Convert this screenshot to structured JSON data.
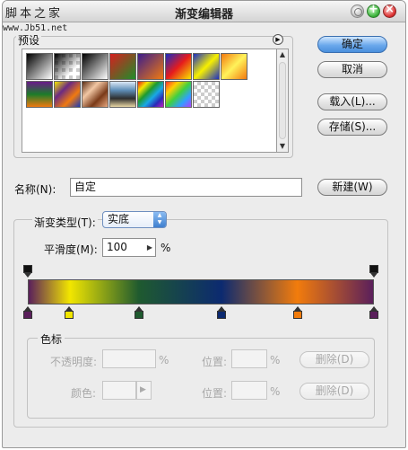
{
  "watermark": {
    "text": "脚本之家",
    "url": "www.Jb51.net"
  },
  "window": {
    "title": "渐变编辑器"
  },
  "presets": {
    "label": "预设",
    "swatches": [
      {
        "name": "foreground-to-background",
        "bg": "linear-gradient(135deg,#000,#fff)"
      },
      {
        "name": "foreground-to-transparent",
        "bg": "checker-black"
      },
      {
        "name": "black-white",
        "bg": "linear-gradient(135deg,#000,#fff)"
      },
      {
        "name": "red-green",
        "bg": "linear-gradient(135deg,#d61f1f,#1e8e2a)"
      },
      {
        "name": "violet-orange",
        "bg": "linear-gradient(135deg,#3b1d8c,#f07a10)"
      },
      {
        "name": "blue-red-yellow",
        "bg": "linear-gradient(135deg,#1a2bc0,#e61c1c,#f6e600)"
      },
      {
        "name": "blue-yellow-blue",
        "bg": "linear-gradient(135deg,#1c2fc4,#f7f000,#1c2fc4)"
      },
      {
        "name": "orange-yellow-orange",
        "bg": "linear-gradient(135deg,#f37a0f,#fff25a,#f37a0f)"
      },
      {
        "name": "violet-green-orange",
        "bg": "linear-gradient(to bottom,#6a1b8a,#1c7c2a,#f07a10)"
      },
      {
        "name": "yellow-violet-orange-blue",
        "bg": "linear-gradient(135deg,#f4e800,#6b2a82,#f07a10,#1d3ab5)"
      },
      {
        "name": "copper",
        "bg": "linear-gradient(135deg,#5a2c14,#f2c7a4,#7a3a18,#e8a880)"
      },
      {
        "name": "chrome",
        "bg": "linear-gradient(to bottom,#dbe8f5,#5f8fb8,#2e2e2e,#e9d7a4)"
      },
      {
        "name": "spectrum",
        "bg": "linear-gradient(135deg,#e61c1c,#f6e600,#1e9a2e,#19a8e6,#2a2ab8,#c21ec2)"
      },
      {
        "name": "transparent-rainbow",
        "bg": "linear-gradient(135deg,#ff3030,#ffd000,#40d040,#30a0ff,#b040ff)"
      },
      {
        "name": "transparent-stripes",
        "bg": "checker-light"
      }
    ]
  },
  "buttons": {
    "ok": "确定",
    "cancel": "取消",
    "load": "载入(L)...",
    "save": "存储(S)...",
    "new": "新建(W)",
    "delete_opacity": "删除(D)",
    "delete_color": "删除(D)"
  },
  "name_field": {
    "label": "名称(N):",
    "value": "自定"
  },
  "gradient_type": {
    "label": "渐变类型(T):",
    "value": "实底"
  },
  "smoothness": {
    "label": "平滑度(M):",
    "value": "100",
    "unit": "%"
  },
  "gradient": {
    "color_stops": [
      {
        "position": 0.0,
        "color": "#5a1f5b"
      },
      {
        "position": 0.12,
        "color": "#f2e600"
      },
      {
        "position": 0.32,
        "color": "#1f5a2f"
      },
      {
        "position": 0.56,
        "color": "#0c2a70"
      },
      {
        "position": 0.78,
        "color": "#f27c0c"
      },
      {
        "position": 1.0,
        "color": "#5a1f5b"
      }
    ],
    "opacity_stops": [
      {
        "position": 0.0
      },
      {
        "position": 1.0
      }
    ]
  },
  "stops_group": {
    "label": "色标",
    "opacity_label": "不透明度:",
    "opacity_unit": "%",
    "location_label": "位置:",
    "location_unit": "%",
    "color_label": "颜色:"
  }
}
